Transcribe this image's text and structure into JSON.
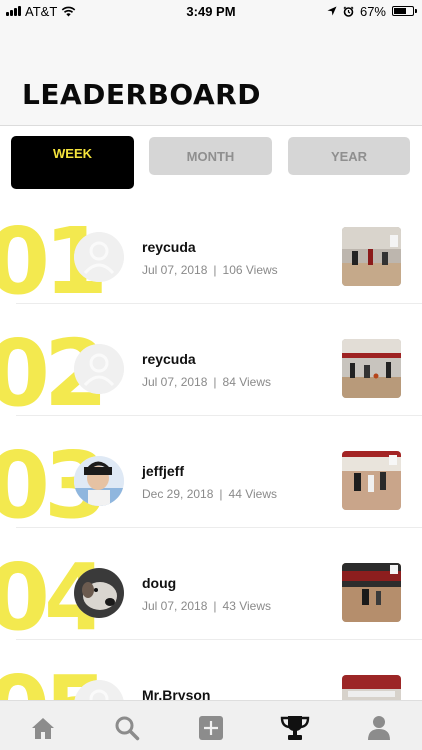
{
  "status_bar": {
    "carrier": "AT&T",
    "time": "3:49 PM",
    "battery": "67%",
    "battery_level": 0.67
  },
  "header": {
    "title": "LEADERBOARD"
  },
  "tabs": [
    {
      "label": "WEEK",
      "active": true
    },
    {
      "label": "MONTH",
      "active": false
    },
    {
      "label": "YEAR",
      "active": false
    }
  ],
  "leaderboard": [
    {
      "rank": "01",
      "username": "reycuda",
      "date": "Jul 07, 2018",
      "views": "106 Views",
      "avatar": "placeholder-user-icon"
    },
    {
      "rank": "02",
      "username": "reycuda",
      "date": "Jul 07, 2018",
      "views": "84 Views",
      "avatar": "placeholder-user-icon"
    },
    {
      "rank": "03",
      "username": "jeffjeff",
      "date": "Dec 29, 2018",
      "views": "44 Views",
      "avatar": "photo-child"
    },
    {
      "rank": "04",
      "username": "doug",
      "date": "Jul 07, 2018",
      "views": "43 Views",
      "avatar": "photo-dog"
    },
    {
      "rank": "05",
      "username": "Mr.Bryson",
      "date": "",
      "views": "",
      "avatar": "placeholder-user-icon"
    }
  ],
  "separator": "|",
  "bottom_nav": [
    {
      "icon": "home-icon",
      "active": false
    },
    {
      "icon": "search-icon",
      "active": false
    },
    {
      "icon": "add-icon",
      "active": false
    },
    {
      "icon": "trophy-icon",
      "active": true
    },
    {
      "icon": "profile-icon",
      "active": false
    }
  ],
  "colors": {
    "accent_yellow": "#f3e23c",
    "rank_yellow": "#f3e94f",
    "active_tab_bg": "#000000",
    "inactive_tab_bg": "#d6d6d6",
    "icon_inactive": "#8c8c8c",
    "icon_active": "#111111"
  }
}
